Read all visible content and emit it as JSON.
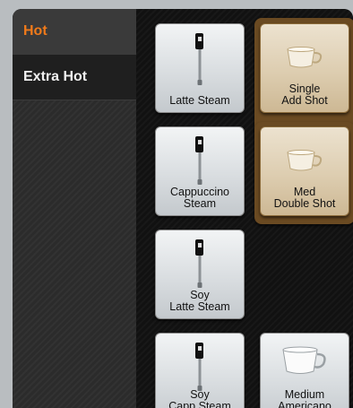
{
  "sidebar": {
    "items": [
      {
        "label": "Hot",
        "active": true
      },
      {
        "label": "Extra Hot",
        "active": false
      }
    ]
  },
  "tiles": [
    {
      "label": "Latte Steam",
      "icon": "steam-wand-icon"
    },
    {
      "label": "Single\nAdd Shot",
      "icon": "cup-icon",
      "selected": true
    },
    {
      "label": "Cappuccino\nSteam",
      "icon": "steam-wand-icon"
    },
    {
      "label": "Med\nDouble Shot",
      "icon": "cup-icon",
      "selected": true
    },
    {
      "label": "Soy\nLatte Steam",
      "icon": "steam-wand-icon"
    },
    {
      "label": "Soy\nCapp Steam",
      "icon": "steam-wand-icon"
    },
    {
      "label": "Medium\nAmericano",
      "icon": "cup-icon"
    }
  ],
  "colors": {
    "accent": "#f07a1a",
    "selected_border": "#6a4a22",
    "tile_silver": "#dfe3e6",
    "tile_tan": "#ddcdb0"
  }
}
